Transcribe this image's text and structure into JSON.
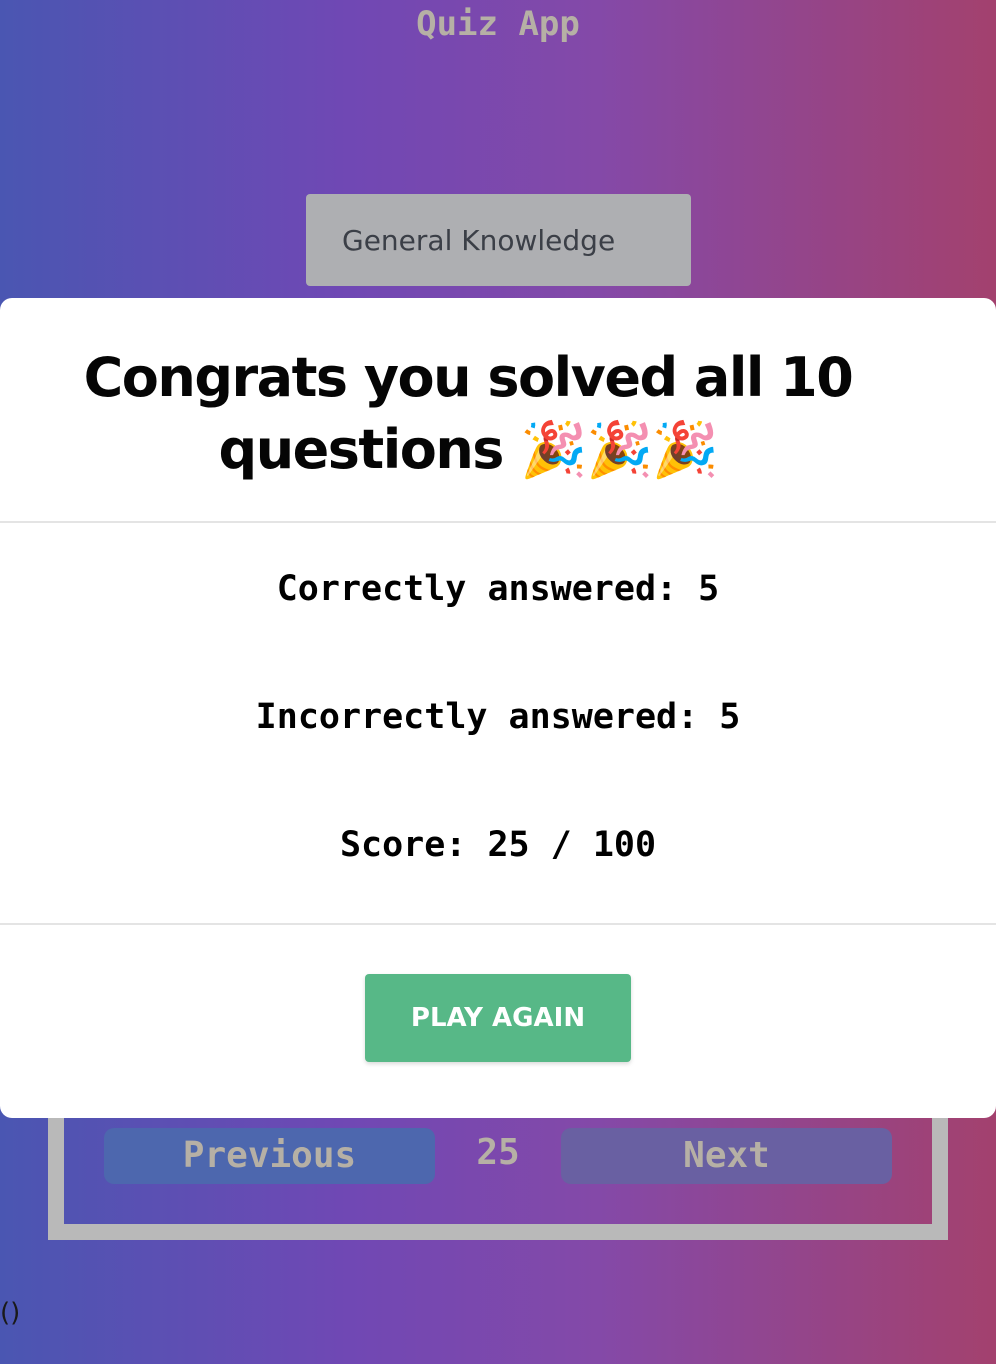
{
  "app": {
    "title": "Quiz App"
  },
  "category": {
    "selected": "General Knowledge"
  },
  "pagination": {
    "previous_label": "Previous",
    "next_label": "Next",
    "current_page": "25"
  },
  "stray_text": "()",
  "modal": {
    "title": "Congrats you solved all 10 questions 🎉🎉🎉",
    "correct": "Correctly answered: 5",
    "incorrect": "Incorrectly answered: 5",
    "score": "Score: 25 / 100",
    "play_again_label": "PLAY AGAIN"
  },
  "colors": {
    "play_again": "#57b887",
    "previous_button": "#4d67ae",
    "next_button": "#6960a2"
  }
}
